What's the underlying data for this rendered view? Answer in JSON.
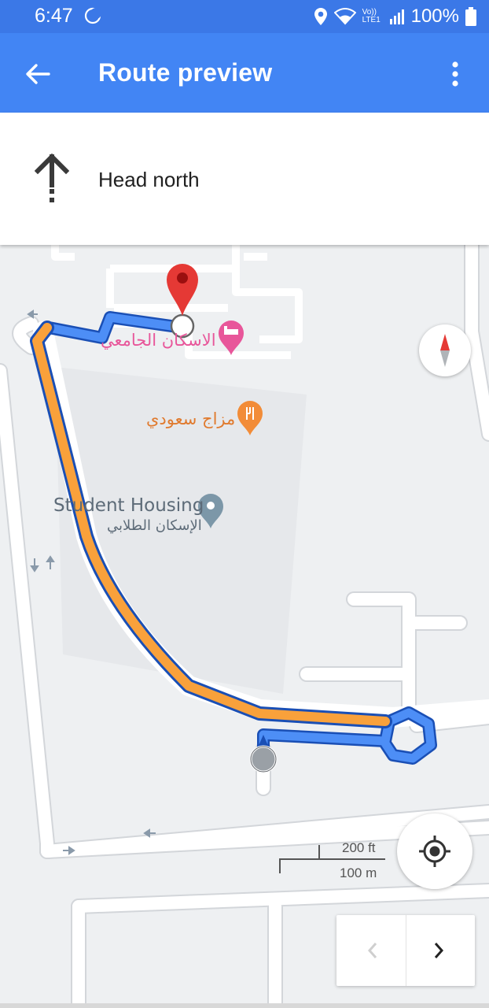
{
  "status_bar": {
    "time": "6:47",
    "network_label": "Vo)) LTE1",
    "battery": "100%"
  },
  "app_bar": {
    "title": "Route preview",
    "back_icon": "arrow-back-icon",
    "menu_icon": "more-vert-icon"
  },
  "direction": {
    "instruction": "Head north",
    "icon": "arrow-up-icon"
  },
  "map": {
    "poi": {
      "hotel": "الاسكان الجامعي",
      "restaurant": "مزاج سعودي",
      "housing_en": "Student Housing",
      "housing_ar": "الإسكان الطلابي"
    },
    "scale": {
      "feet": "200 ft",
      "meters": "100 m"
    },
    "colors": {
      "route_primary": "#f9a13b",
      "route_alternate": "#4d8ef6",
      "destination_pin": "#e53935",
      "hotel_pin": "#e8569a",
      "food_pin": "#f28c38",
      "housing_pin": "#7c97a8"
    }
  },
  "controls": {
    "compass_icon": "compass-icon",
    "my_location_icon": "my-location-icon",
    "prev_icon": "chevron-left-icon",
    "next_icon": "chevron-right-icon"
  }
}
